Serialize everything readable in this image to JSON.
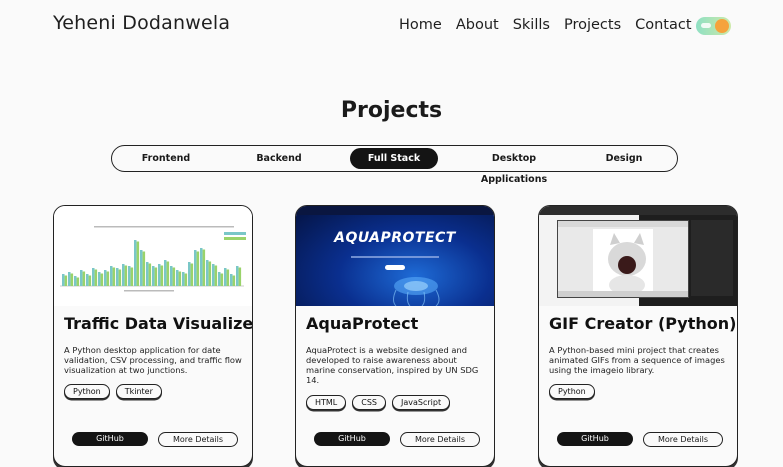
{
  "header": {
    "brand": "Yeheni Dodanwela",
    "nav": [
      "Home",
      "About",
      "Skills",
      "Projects",
      "Contact"
    ]
  },
  "section": {
    "title": "Projects"
  },
  "tabs": [
    {
      "label": "Frontend",
      "active": false
    },
    {
      "label": "Backend",
      "active": false
    },
    {
      "label": "Full Stack",
      "active": true
    },
    {
      "label": "Desktop Applications",
      "active": false
    },
    {
      "label": "Design",
      "active": false
    }
  ],
  "cards": [
    {
      "title": "Traffic Data Visualizer",
      "description": "A Python desktop application for date validation, CSV processing, and traffic flow visualization at two junctions.",
      "tags": [
        "Python",
        "Tkinter"
      ],
      "github_label": "GitHub",
      "details_label": "More Details"
    },
    {
      "title": "AquaProtect",
      "thumb_heading": "AQUAPROTECT",
      "description": "AquaProtect is a website designed and developed to raise awareness about marine conservation, inspired by UN SDG 14.",
      "tags": [
        "HTML",
        "CSS",
        "JavaScript"
      ],
      "github_label": "GitHub",
      "details_label": "More Details"
    },
    {
      "title": "GIF Creator (Python)",
      "description": "A Python-based mini project that creates animated GIFs from a sequence of images using the imageio library.",
      "tags": [
        "Python"
      ],
      "github_label": "GitHub",
      "details_label": "More Details"
    }
  ],
  "colors": {
    "accent_dark": "#141414",
    "toggle_start": "#8fe0c4",
    "toggle_knob": "#f5a33c",
    "aqua_bg": "#061a5c"
  }
}
